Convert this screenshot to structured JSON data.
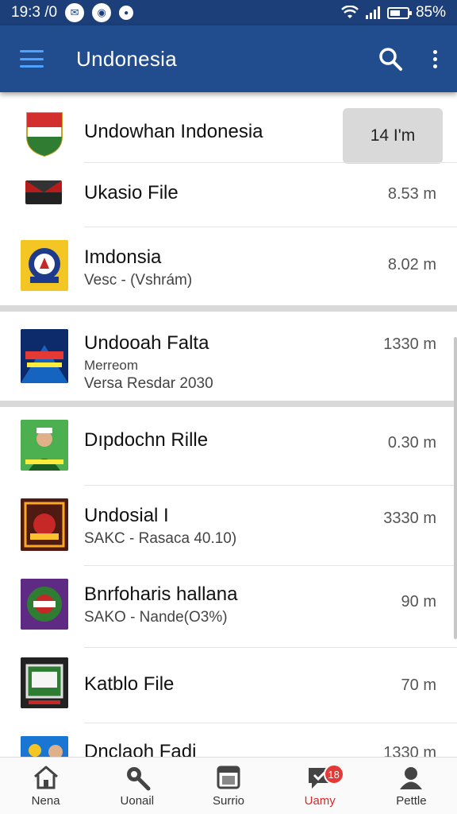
{
  "status_bar": {
    "time": "19:3 /0",
    "battery": "85%"
  },
  "app_bar": {
    "title": "Undonesia"
  },
  "items": [
    {
      "title": "Undowhan Indonesia",
      "subtitle": "",
      "subtitle2": "",
      "size": "14 I'm",
      "icon": "flag-shield"
    },
    {
      "title": "Ukasio File",
      "subtitle": "",
      "subtitle2": "",
      "size": "8.53 m",
      "icon": "flag-bar"
    },
    {
      "title": "Imdonsia",
      "subtitle": "Vesc - (Vshrám)",
      "subtitle2": "",
      "size": "8.02 m",
      "icon": "emblem"
    },
    {
      "title": "Undooah Falta",
      "subtitle": "Merreom",
      "subtitle2": "Versa Resdar 2030",
      "size": "1330 m",
      "icon": "poster"
    },
    {
      "title": "Dıpdochn Rille",
      "subtitle": "",
      "subtitle2": "",
      "size": "0.30 m",
      "icon": "person"
    },
    {
      "title": "Undosial I",
      "subtitle": "SAKC - Rasaca 40.10)",
      "subtitle2": "",
      "size": "3330 m",
      "icon": "ornament"
    },
    {
      "title": "Bnrfoharis hallana",
      "subtitle": "SAKO - Nande(O3%)",
      "subtitle2": "",
      "size": "90 m",
      "icon": "badge-green"
    },
    {
      "title": "Katblo File",
      "subtitle": "",
      "subtitle2": "",
      "size": "70 m",
      "icon": "frame"
    },
    {
      "title": "Dnclaoh Fadi",
      "subtitle": "",
      "subtitle2": "",
      "size": "1330 m",
      "icon": "photo"
    }
  ],
  "nav": [
    {
      "label": "Nena",
      "icon": "home-icon"
    },
    {
      "label": "Uonail",
      "icon": "search-icon"
    },
    {
      "label": "Surrio",
      "icon": "window-icon"
    },
    {
      "label": "Uamy",
      "icon": "chat-icon",
      "badge": "18"
    },
    {
      "label": "Pettle",
      "icon": "profile-icon"
    }
  ],
  "colors": {
    "app_bar": "#214c8e",
    "status_bar": "#1c3f7a",
    "accent": "#e53935"
  }
}
